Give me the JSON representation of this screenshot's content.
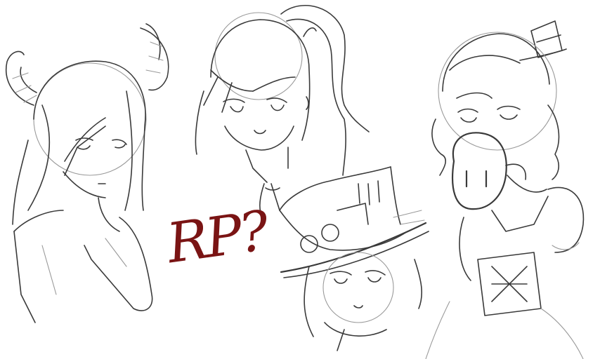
{
  "sketch_text": "RP?",
  "colors": {
    "background": "#ffffff",
    "pencil": "#3a3a3a",
    "pencil_light": "#9a9a9a",
    "text_red": "#7a1414"
  }
}
